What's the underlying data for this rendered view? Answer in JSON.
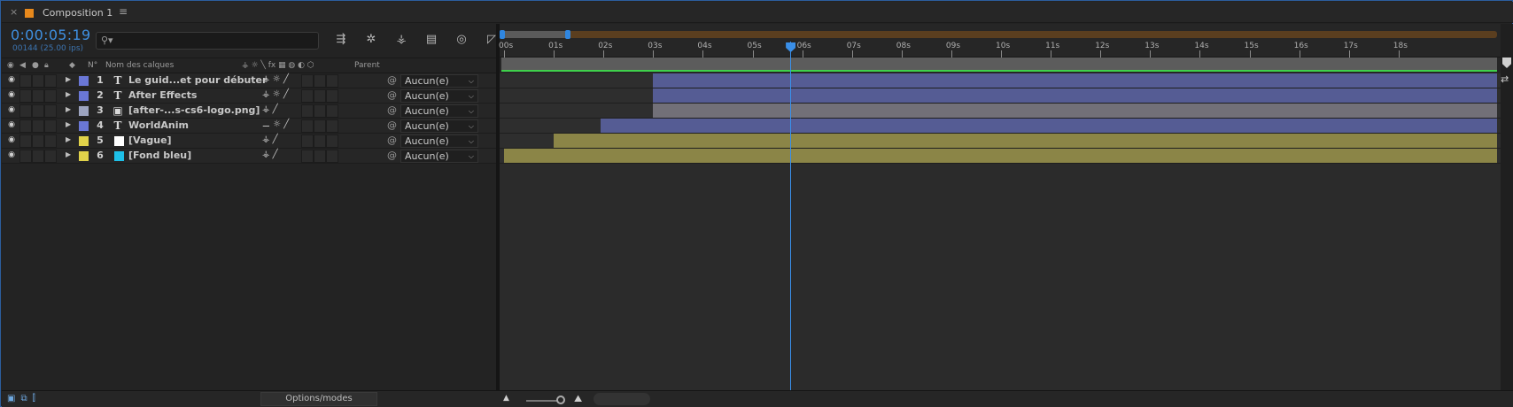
{
  "window": {
    "close": "×",
    "title": "Composition 1",
    "menu": "≡"
  },
  "timecode": {
    "value": "0:00:05:19",
    "frames": "00144 (25.00 ips)"
  },
  "search": {
    "placeholder": ""
  },
  "columns": {
    "number": "N°",
    "name": "Nom des calques",
    "parent": "Parent"
  },
  "layers": [
    {
      "num": "1",
      "type": "T",
      "name": "Le guid...et pour débuter",
      "label_color": "#6a77d6",
      "switch": "⚶ ☼ ╱",
      "parent": "Aucun(e)",
      "bar_color": "#555c94",
      "start_s": 3.0
    },
    {
      "num": "2",
      "type": "T",
      "name": "After Effects",
      "label_color": "#6a77d6",
      "switch": "⚶ ☼ ╱",
      "parent": "Aucun(e)",
      "bar_color": "#555c94",
      "start_s": 3.0
    },
    {
      "num": "3",
      "type": "▣",
      "name": "[after-...s-cs6-logo.png]",
      "label_color": "#9da4c0",
      "switch": "⚶   ╱",
      "parent": "Aucun(e)",
      "bar_color": "#727078",
      "start_s": 3.0
    },
    {
      "num": "4",
      "type": "T",
      "name": "WorldAnim",
      "label_color": "#6a77d6",
      "switch": "⚊ ☼ ╱",
      "parent": "Aucun(e)",
      "bar_color": "#555c94",
      "start_s": 1.95
    },
    {
      "num": "5",
      "type": "□",
      "name": "[Vague]",
      "label_color": "#e0d24a",
      "swatch": "#ffffff",
      "switch": "⚶   ╱",
      "parent": "Aucun(e)",
      "bar_color": "#8b8547",
      "start_s": 1.0
    },
    {
      "num": "6",
      "type": "□",
      "name": "[Fond bleu]",
      "label_color": "#e0d24a",
      "swatch": "#1ec0e8",
      "switch": "⚶   ╱",
      "parent": "Aucun(e)",
      "bar_color": "#8b8547",
      "start_s": 0.0
    }
  ],
  "ruler": {
    "ticks": [
      "00s",
      "01s",
      "02s",
      "03s",
      "04s",
      "05s",
      "06s",
      "07s",
      "08s",
      "09s",
      "10s",
      "11s",
      "12s",
      "13s",
      "14s",
      "15s",
      "16s",
      "17s",
      "18s"
    ],
    "current_s": 5.76,
    "end_s": 18.3
  },
  "bottom": {
    "options_label": "Options/modes"
  },
  "colors": {
    "accent": "#3a8fe8",
    "workarea_green": "#3fd14c",
    "nav_orange": "#5a3e1f"
  }
}
